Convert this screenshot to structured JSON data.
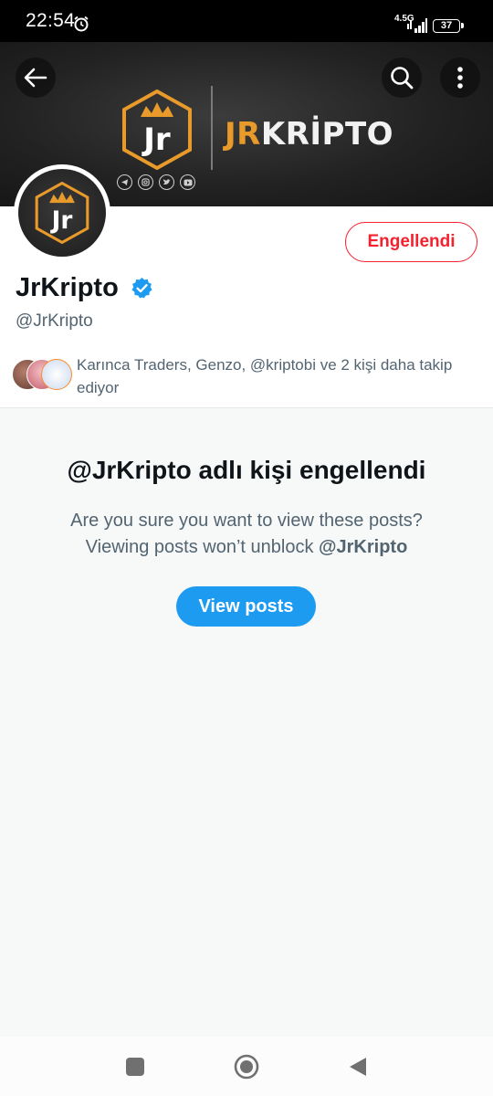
{
  "status_bar": {
    "time": "22:54",
    "network": "4.5G",
    "battery": "37",
    "icons": [
      "alarm-icon",
      "signal-icon",
      "battery-icon"
    ]
  },
  "header": {
    "banner_brand_prefix": "JR",
    "banner_brand_suffix": "KRİPTO",
    "logo_text": "Jr",
    "icons": [
      "back-arrow-icon",
      "search-icon",
      "more-vertical-icon"
    ],
    "social_icons": [
      "telegram-icon",
      "instagram-icon",
      "twitter-icon",
      "youtube-icon"
    ]
  },
  "profile": {
    "display_name": "JrKripto",
    "handle": "@JrKripto",
    "verified": true,
    "blocked_button_label": "Engellendi",
    "followed_by_text": "Karınca Traders, Genzo, @kriptobi ve 2 kişi daha takip ediyor"
  },
  "blocked_notice": {
    "title": "@JrKripto adlı kişi engellendi",
    "line1": "Are you sure you want to view these posts?",
    "line2_prefix": "Viewing posts won’t unblock ",
    "line2_handle": "@JrKripto",
    "button_label": "View posts"
  },
  "colors": {
    "accent": "#1d9bf0",
    "danger": "#f4212e",
    "secondary_text": "#536471",
    "brand_orange": "#e89a2a"
  },
  "nav_bar": {
    "icons": [
      "recents-square-icon",
      "home-circle-icon",
      "back-triangle-icon"
    ]
  }
}
